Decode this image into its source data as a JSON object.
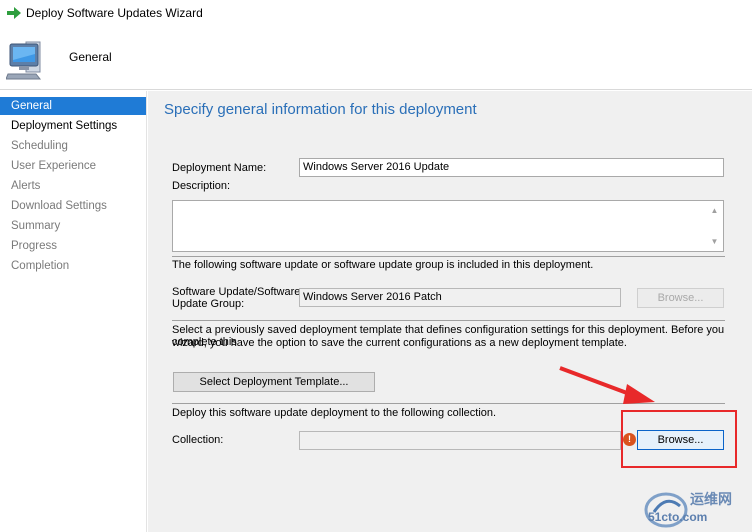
{
  "window": {
    "title": "Deploy Software Updates Wizard"
  },
  "header": {
    "title": "General"
  },
  "sidebar": {
    "items": [
      {
        "label": "General"
      },
      {
        "label": "Deployment Settings"
      },
      {
        "label": "Scheduling"
      },
      {
        "label": "User Experience"
      },
      {
        "label": "Alerts"
      },
      {
        "label": "Download Settings"
      },
      {
        "label": "Summary"
      },
      {
        "label": "Progress"
      },
      {
        "label": "Completion"
      }
    ]
  },
  "main": {
    "heading": "Specify general information for this deployment",
    "deployment_name_label": "Deployment Name:",
    "deployment_name_value": "Windows Server 2016 Update",
    "description_label": "Description:",
    "description_value": "",
    "included_text": "The following software update or software update group is included in this deployment.",
    "update_group_label_1": "Software Update/Software",
    "update_group_label_2": "Update Group:",
    "update_group_value": "Windows Server 2016 Patch",
    "browse_disabled_label": "Browse...",
    "template_text_1": "Select a previously saved deployment template that defines configuration settings for this deployment. Before you complete this",
    "template_text_2": "wizard, you have the option to save the current configurations as a new deployment template.",
    "select_template_label": "Select Deployment Template...",
    "collection_text": "Deploy this software update deployment to the following collection.",
    "collection_label": "Collection:",
    "collection_value": "",
    "error_glyph": "!",
    "browse_label": "Browse..."
  },
  "watermark": {
    "line1": "运维网",
    "line2": "51cto.com"
  },
  "colors": {
    "accent": "#1f7bd6",
    "heading": "#2a6fb8",
    "annotation": "#e8292a",
    "error": "#d9531e"
  }
}
